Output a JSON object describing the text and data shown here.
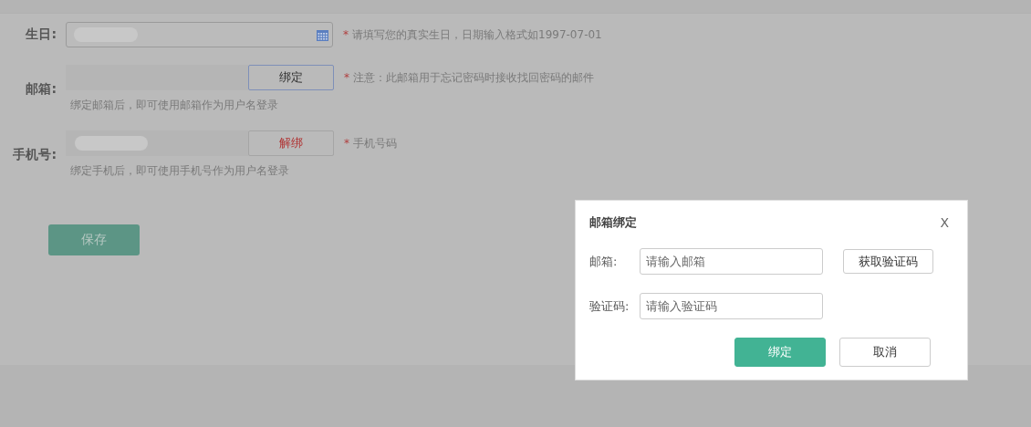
{
  "form": {
    "rows": [
      {
        "kind": "date",
        "label": "生日:",
        "hint_mark": "*",
        "hint": "请填写您的真实生日，日期输入格式如1997-07-01"
      },
      {
        "kind": "bound",
        "label": "邮箱:",
        "button": {
          "label": "绑定",
          "kind": "default",
          "focused": true
        },
        "hint_mark": "*",
        "hint": "注意：此邮箱用于忘记密码时接收找回密码的邮件",
        "note": "绑定邮箱后，即可使用邮箱作为用户名登录"
      },
      {
        "kind": "bound",
        "label": "手机号:",
        "button": {
          "label": "解绑",
          "kind": "danger",
          "focused": false
        },
        "hint_mark": "*",
        "hint": "手机号码",
        "note": "绑定手机后，即可使用手机号作为用户名登录"
      }
    ],
    "save_button": "保存"
  },
  "dialog": {
    "title": "邮箱绑定",
    "close": "X",
    "fields": [
      {
        "label": "邮箱:",
        "placeholder": "请输入邮箱",
        "action": "获取验证码"
      },
      {
        "label": "验证码:",
        "placeholder": "请输入验证码"
      }
    ],
    "buttons": [
      {
        "label": "绑定",
        "kind": "primary"
      },
      {
        "label": "取消",
        "kind": "default"
      }
    ]
  }
}
